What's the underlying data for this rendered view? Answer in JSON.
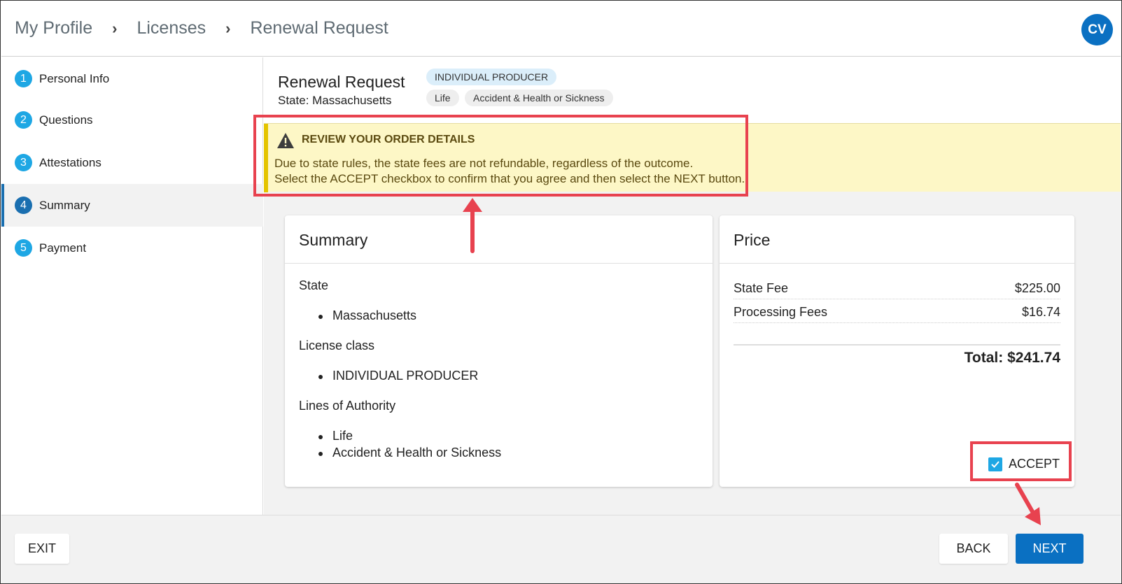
{
  "breadcrumb": [
    "My Profile",
    "Licenses",
    "Renewal Request"
  ],
  "breadcrumb_separator": "›",
  "user": {
    "initials": "CV"
  },
  "steps": [
    {
      "num": "1",
      "label": "Personal Info"
    },
    {
      "num": "2",
      "label": "Questions"
    },
    {
      "num": "3",
      "label": "Attestations"
    },
    {
      "num": "4",
      "label": "Summary"
    },
    {
      "num": "5",
      "label": "Payment"
    }
  ],
  "header": {
    "title": "Renewal Request",
    "state": "State: Massachusetts",
    "license_chip": "INDIVIDUAL PRODUCER",
    "authority_chips": [
      "Life",
      "Accident & Health or Sickness"
    ]
  },
  "alert": {
    "title": "REVIEW YOUR ORDER DETAILS",
    "line1": "Due to state rules, the state fees are not refundable, regardless of the outcome.",
    "line2": "Select the ACCEPT checkbox to confirm that you agree and then select the NEXT button."
  },
  "summary": {
    "title": "Summary",
    "state_label": "State",
    "state_items": [
      "Massachusetts"
    ],
    "license_label": "License class",
    "license_items": [
      "INDIVIDUAL PRODUCER"
    ],
    "loa_label": "Lines of Authority",
    "loa_items": [
      "Life",
      "Accident & Health or Sickness"
    ]
  },
  "price": {
    "title": "Price",
    "rows": [
      {
        "label": "State Fee",
        "value": "$225.00"
      },
      {
        "label": "Processing Fees",
        "value": "$16.74"
      }
    ],
    "total": "Total: $241.74",
    "accept_label": "ACCEPT",
    "accept_checked": true
  },
  "footer": {
    "exit": "EXIT",
    "back": "BACK",
    "next": "NEXT"
  },
  "colors": {
    "primary": "#0a70c2",
    "step": "#1ea7e4",
    "alert_bg": "#fdf7c6",
    "annotation": "#e8424f"
  }
}
